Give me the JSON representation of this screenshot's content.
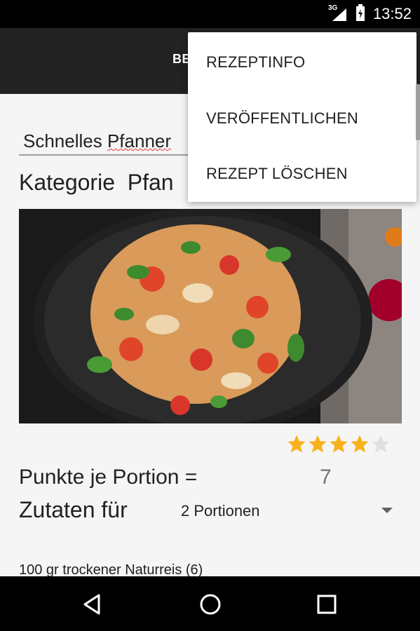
{
  "status_bar": {
    "time": "13:52",
    "network_label": "3G"
  },
  "app_bar": {
    "title_partial": "BE"
  },
  "recipe": {
    "title_start": "Schnelles ",
    "title_misspelled": "Pfanner",
    "category_label": "Kategorie",
    "category_value": "Pfan",
    "rating": {
      "value": 4,
      "max": 5,
      "color_filled": "#f9b11c",
      "color_empty": "#e0e0e0"
    },
    "points_label": "Punkte je Portion =",
    "points_value": "7",
    "servings_label": "Zutaten für",
    "servings_selected": "2 Portionen",
    "ingredient_first": "100 gr trockener Naturreis (6)"
  },
  "menu": {
    "items": [
      {
        "label": "REZEPTINFO"
      },
      {
        "label": "VERÖFFENTLICHEN"
      },
      {
        "label": "REZEPT LÖSCHEN"
      }
    ]
  },
  "nav_bar": {
    "icons": [
      "back-icon",
      "home-icon",
      "recents-icon"
    ]
  },
  "colors": {
    "appbar": "#222222",
    "statusbar": "#000000",
    "spellcheck": "#e53935"
  }
}
